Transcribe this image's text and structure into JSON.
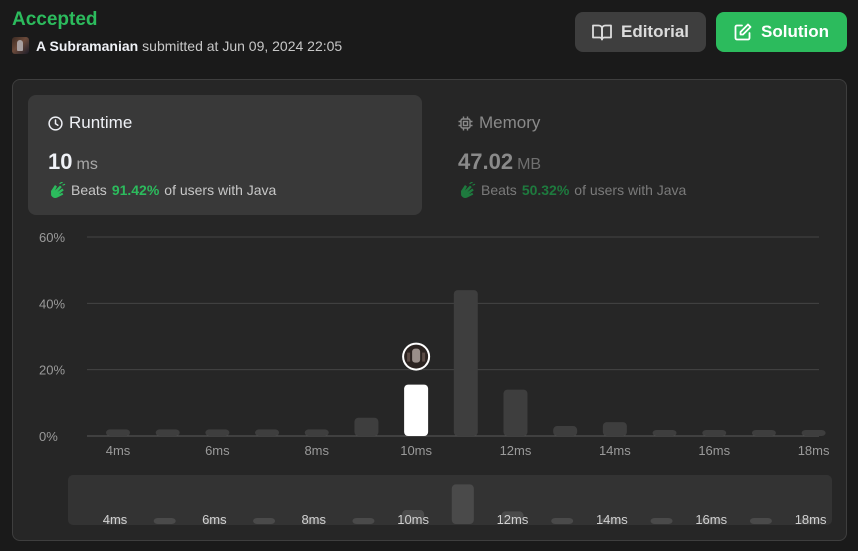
{
  "status": "Accepted",
  "submitter": {
    "name": "A Subramanian",
    "text": "submitted at Jun 09, 2024 22:05"
  },
  "buttons": {
    "editorial": "Editorial",
    "solution": "Solution"
  },
  "runtime": {
    "title": "Runtime",
    "value": "10",
    "unit": "ms",
    "beats_prefix": "Beats",
    "beats_pct": "91.42%",
    "beats_suffix": "of users with Java"
  },
  "memory": {
    "title": "Memory",
    "value": "47.02",
    "unit": "MB",
    "beats_prefix": "Beats",
    "beats_pct": "50.32%",
    "beats_suffix": "of users with Java"
  },
  "colors": {
    "accent": "#2cbb5d",
    "bar": "#3e3e3e",
    "highlight": "#ffffff"
  },
  "chart_data": {
    "type": "bar",
    "ylabel": "",
    "xlabel": "",
    "y_ticks": [
      "0%",
      "20%",
      "40%",
      "60%"
    ],
    "ylim": [
      0,
      60
    ],
    "x_tick_labels": [
      "4ms",
      "6ms",
      "8ms",
      "10ms",
      "12ms",
      "14ms",
      "16ms",
      "18ms"
    ],
    "categories": [
      4,
      5,
      6,
      7,
      8,
      9,
      10,
      11,
      12,
      13,
      14,
      15,
      16,
      17,
      18
    ],
    "values": [
      2.0,
      2.0,
      2.0,
      2.0,
      2.0,
      5.5,
      15.5,
      44.0,
      14.0,
      3.0,
      4.2,
      1.8,
      1.8,
      1.8,
      1.8
    ],
    "highlight_category": 10,
    "grid": true
  }
}
